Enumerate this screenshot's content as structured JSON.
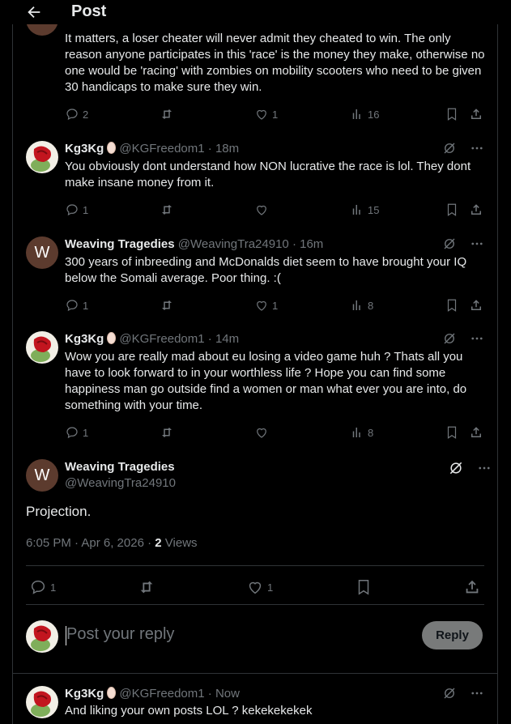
{
  "header": {
    "title": "Post"
  },
  "tweets": [
    {
      "text": "It matters, a loser cheater will never admit they cheated to win. The only reason anyone participates in this 'race' is the money they make, otherwise no one would be 'racing' with zombies on mobility scooters who need to be given 30 handicaps to make sure they win.",
      "replies": "2",
      "likes": "1",
      "views": "16"
    },
    {
      "name": "Kg3Kg",
      "handle": "@KGFreedom1",
      "time": "· 18m",
      "text": "You obviously dont understand how NON lucrative the race is lol. They dont make insane money from it.",
      "replies": "1",
      "likes": "",
      "views": "15"
    },
    {
      "name": "Weaving Tragedies",
      "handle": "@WeavingTra24910",
      "time": "· 16m",
      "avatar_letter": "W",
      "text": "300 years of inbreeding and McDonalds diet seem to have brought your IQ below the Somali average. Poor thing. :(",
      "replies": "1",
      "likes": "1",
      "views": "8"
    },
    {
      "name": "Kg3Kg",
      "handle": "@KGFreedom1",
      "time": "· 14m",
      "text": "Wow you are really mad about eu losing a video game huh ? Thats all you have to look forward to in your worthless life ? Hope you can find some happiness man go outside find a women or man what ever you are into, do something with your time.",
      "replies": "1",
      "likes": "",
      "views": "8"
    }
  ],
  "main_post": {
    "name": "Weaving Tragedies",
    "handle": "@WeavingTra24910",
    "avatar_letter": "W",
    "text": "Projection.",
    "time": "6:05 PM · Apr 6, 2026 ·",
    "views_count": "2",
    "views_label": "Views",
    "replies": "1",
    "likes": "1"
  },
  "reply_box": {
    "placeholder": "Post your reply",
    "button": "Reply"
  },
  "last_reply": {
    "name": "Kg3Kg",
    "handle": "@KGFreedom1",
    "time": "· Now",
    "text": "And liking your own posts LOL ? kekekekekek"
  },
  "colors": {
    "background": "#000000",
    "text": "#e7e9ea",
    "muted": "#71767b",
    "border": "#2f3336",
    "button": "#787a7a"
  },
  "icons": [
    "back-arrow-icon",
    "reply-icon",
    "repost-icon",
    "like-icon",
    "views-icon",
    "bookmark-icon",
    "share-icon",
    "grok-icon",
    "more-icon"
  ]
}
